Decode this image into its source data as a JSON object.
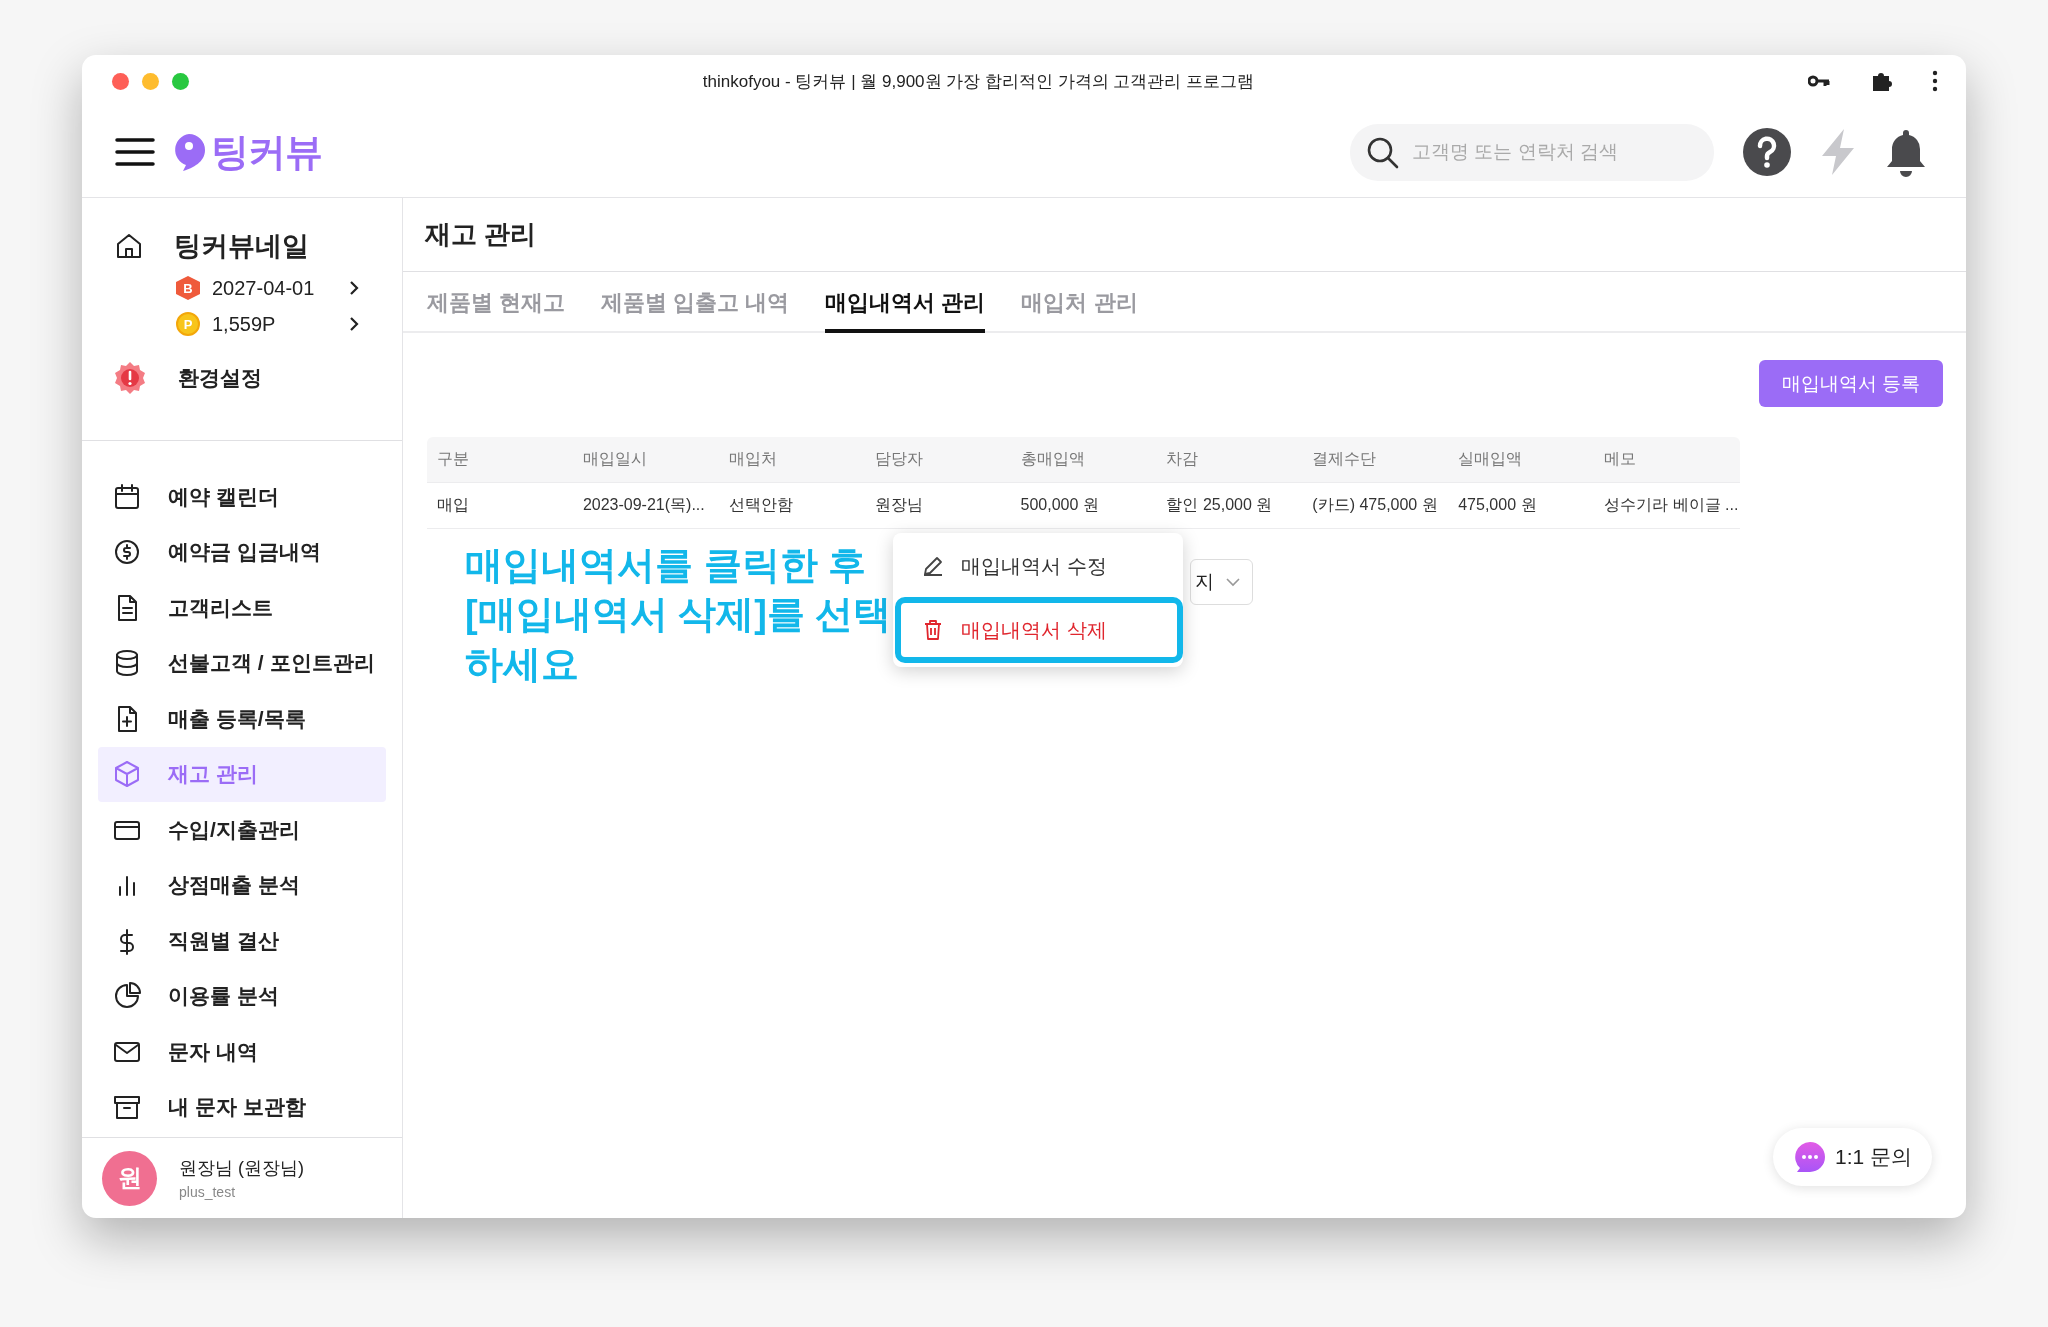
{
  "window": {
    "title": "thinkofyou - 팅커뷰 | 월 9,900원 가장 합리적인 가격의 고객관리 프로그램"
  },
  "header": {
    "logo": "팅커뷰",
    "search": {
      "placeholder": "고객명 또는 연락처 검색"
    }
  },
  "sidebar": {
    "shop": {
      "name": "팅커뷰네일",
      "expiry_badge": "B",
      "expiry": "2027-04-01",
      "points_badge": "P",
      "points": "1,559P"
    },
    "settings": "환경설정",
    "items": [
      {
        "label": "예약 캘린더",
        "selected": false
      },
      {
        "label": "예약금 입금내역",
        "selected": false
      },
      {
        "label": "고객리스트",
        "selected": false
      },
      {
        "label": "선불고객 / 포인트관리",
        "selected": false
      },
      {
        "label": "매출 등록/목록",
        "selected": false
      },
      {
        "label": "재고 관리",
        "selected": true
      },
      {
        "label": "수입/지출관리",
        "selected": false
      },
      {
        "label": "상점매출 분석",
        "selected": false
      },
      {
        "label": "직원별 결산",
        "selected": false
      },
      {
        "label": "이용률 분석",
        "selected": false
      },
      {
        "label": "문자 내역",
        "selected": false
      },
      {
        "label": "내 문자 보관함",
        "selected": false
      }
    ],
    "user": {
      "avatar": "원",
      "name": "원장님 (원장님)",
      "id": "plus_test"
    }
  },
  "page": {
    "title": "재고 관리",
    "tabs": [
      {
        "label": "제품별 현재고",
        "selected": false
      },
      {
        "label": "제품별 입출고 내역",
        "selected": false
      },
      {
        "label": "매입내역서 관리",
        "selected": true
      },
      {
        "label": "매입처 관리",
        "selected": false
      }
    ],
    "register_button": "매입내역서 등록"
  },
  "table": {
    "columns": [
      "구분",
      "매입일시",
      "매입처",
      "담당자",
      "총매입액",
      "차감",
      "결제수단",
      "실매입액",
      "메모"
    ],
    "rows": [
      {
        "cells": [
          "매입",
          "2023-09-21(목)...",
          "선택안함",
          "원장님",
          "500,000 원",
          "할인 25,000 원",
          "(카드) 475,000 원",
          "475,000 원",
          "성수기라 베이글 ..."
        ]
      }
    ]
  },
  "page_size": "지",
  "context_menu": {
    "items": [
      {
        "label": "매입내역서 수정",
        "kind": "edit",
        "highlighted": false
      },
      {
        "label": "매입내역서 삭제",
        "kind": "delete",
        "highlighted": true
      }
    ]
  },
  "annotation": "매입내역서를 클릭한 후 [매입내역서 삭제]를 선택하세요",
  "chat_button": "1:1 문의"
}
